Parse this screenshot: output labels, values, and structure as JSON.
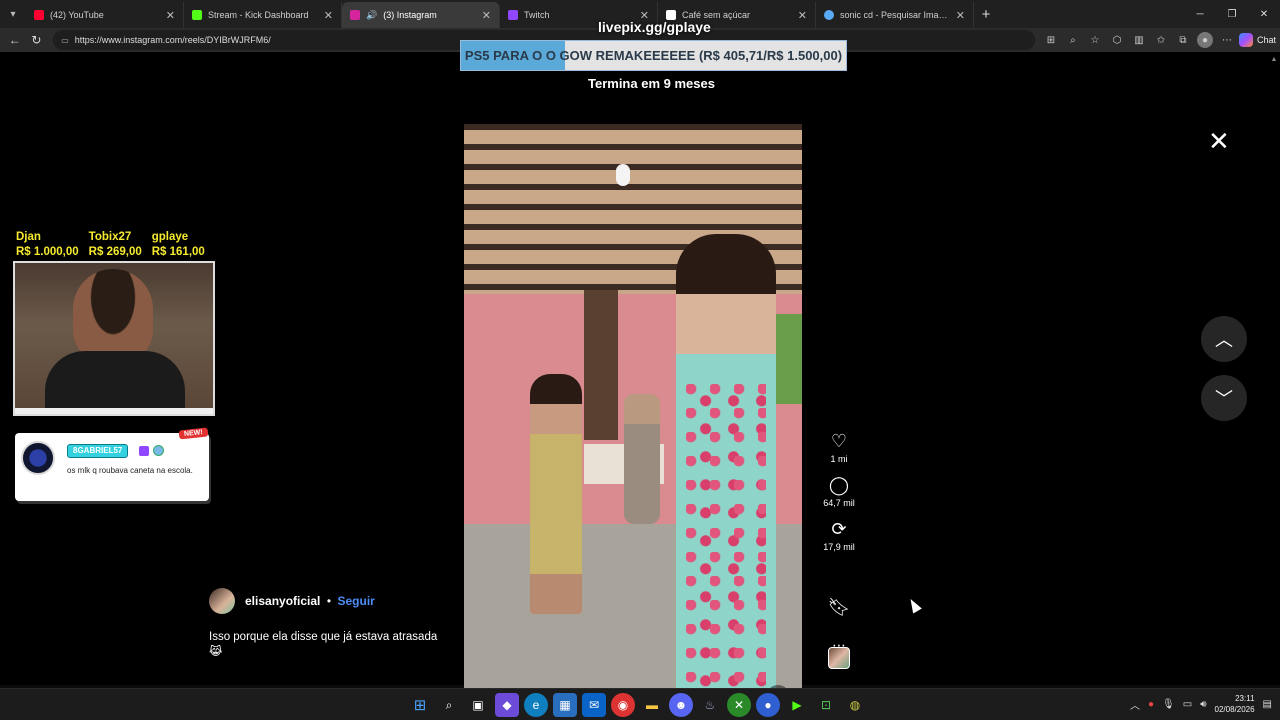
{
  "browser": {
    "tabs": [
      {
        "title": "(42) YouTube",
        "color": "#ff0033"
      },
      {
        "title": "Stream - Kick Dashboard",
        "color": "#53fc18"
      },
      {
        "title": "(3) Instagram",
        "color": "#d6249f",
        "active": true
      },
      {
        "title": "Twitch",
        "color": "#9146ff"
      },
      {
        "title": "Café sem açúcar",
        "color": "#ffffff"
      },
      {
        "title": "sonic cd - Pesquisar Imagens",
        "color": "#5aa9f5"
      }
    ],
    "url": "https://www.instagram.com/reels/DYIBrWJRFM6/",
    "copilot_label": "Chat"
  },
  "overlay": {
    "site": "livepix.gg/gplaye",
    "goal_text": "PS5 PARA O O GOW REMAKEEEEEE (R$ 405,71/R$ 1.500,00)",
    "goal_progress": 0.27,
    "goal_sub": "Termina em 9 meses",
    "donors": [
      {
        "name": "Djan",
        "amount": "R$ 1.000,00"
      },
      {
        "name": "Tobix27",
        "amount": "R$ 269,00"
      },
      {
        "name": "gplaye",
        "amount": "R$ 161,00"
      }
    ],
    "chat": {
      "user": "8GABRIEL57",
      "message": "os mlk q roubava caneta na escola.",
      "tag": "NEW!"
    }
  },
  "reel": {
    "author": "elisanyoficial",
    "separator": "•",
    "follow_label": "Seguir",
    "caption": "Isso porque ela disse que já estava atrasada 😹",
    "likes": "1 mi",
    "comments": "64,7 mil",
    "reposts": "17,9 mil",
    "video_progress": 0.27
  },
  "taskbar": {
    "time": "23:11",
    "date": "02/08/2026"
  },
  "colors": {
    "accent_link": "#4e8df5",
    "donor_yellow": "#f5ea2e",
    "goal_fill": "#5aa9d9"
  }
}
